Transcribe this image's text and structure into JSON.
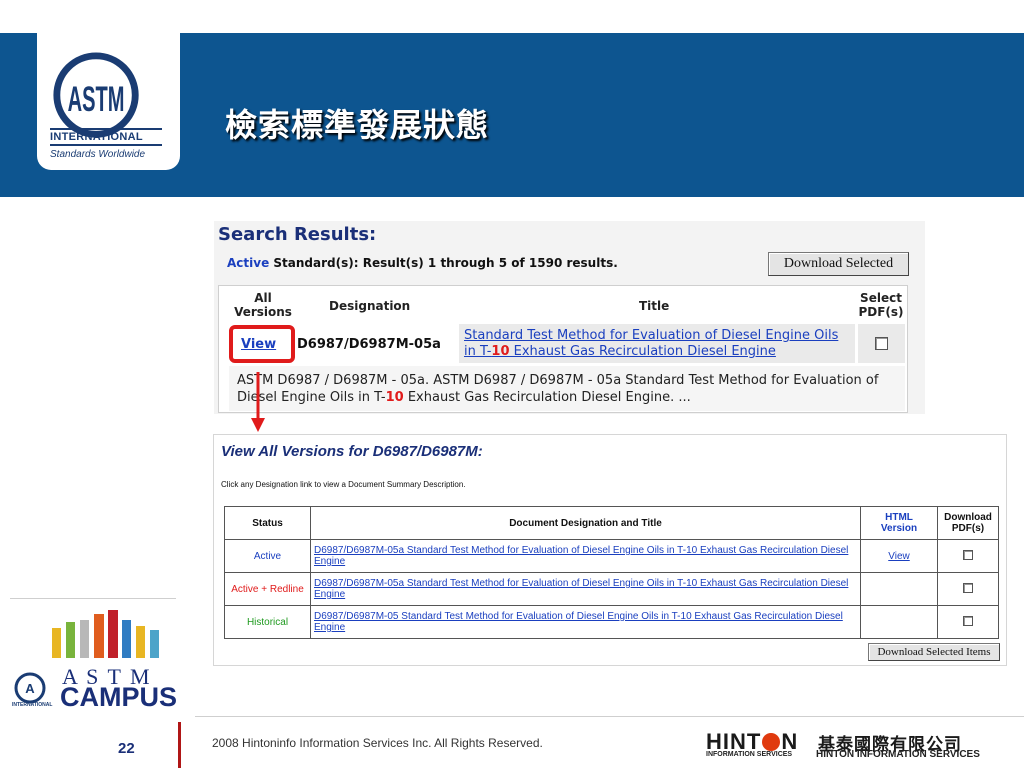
{
  "header": {
    "title": "檢索標準發展狀態",
    "logo": {
      "text": "ASTM",
      "intl": "INTERNATIONAL",
      "tagline": "Standards Worldwide"
    },
    "band_color": "#0d5590"
  },
  "search": {
    "heading": "Search Results:",
    "summary_status": "Active",
    "summary_rest": "Standard(s): Result(s) 1 through 5 of 1590 results.",
    "download_button": "Download Selected",
    "columns": {
      "all_versions_1": "All",
      "all_versions_2": "Versions",
      "designation": "Designation",
      "title": "Title",
      "select_1": "Select",
      "select_2": "PDF(s)"
    },
    "row": {
      "view": "View",
      "designation": "D6987/D6987M-05a",
      "title_a": "Standard Test Method for Evaluation of Diesel Engine Oils in T-",
      "title_hl": "10",
      "title_b": " Exhaust Gas Recirculation Diesel Engine",
      "desc_a": "ASTM D6987 / D6987M - 05a. ASTM D6987 / D6987M - 05a Standard Test Method for Evaluation of Diesel Engine Oils in T-",
      "desc_hl": "10",
      "desc_b": " Exhaust Gas Recirculation Diesel Engine. ..."
    }
  },
  "versions": {
    "heading": "View All Versions for D6987/D6987M:",
    "instruction": "Click any Designation link to view a Document Summary Description.",
    "headers": {
      "status": "Status",
      "doc": "Document Designation and Title",
      "html_1": "HTML",
      "html_2": "Version",
      "dl_1": "Download",
      "dl_2": "PDF(s)"
    },
    "rows": [
      {
        "status": "Active",
        "status_color": "#1a3fbf",
        "doc": "D6987/D6987M-05a Standard Test Method for Evaluation of Diesel Engine Oils in T-10 Exhaust Gas Recirculation Diesel Engine",
        "html": "View"
      },
      {
        "status": "Active + Redline",
        "status_color": "#e01b1b",
        "doc": "D6987/D6987M-05a Standard Test Method for Evaluation of Diesel Engine Oils in T-10 Exhaust Gas Recirculation Diesel Engine",
        "html": ""
      },
      {
        "status": "Historical",
        "status_color": "#1f9a1f",
        "doc": "D6987/D6987M-05 Standard Test Method for Evaluation of Diesel Engine Oils in T-10 Exhaust Gas Recirculation Diesel Engine",
        "html": ""
      }
    ],
    "download_button": "Download Selected Items"
  },
  "campus": {
    "line1": "A S T M",
    "line2": "CAMPUS",
    "small": "INTERNATIONAL"
  },
  "footer": {
    "page": "22",
    "copyright": "2008 Hintoninfo Information Services Inc. All Rights Reserved.",
    "hinton_left": "HINT",
    "hinton_right": "N",
    "hinton_cn": "基泰國際有限公司",
    "hinton_sub": "INFORMATION SERVICES",
    "hinton_sub2": "HINTON  INFORMATION  SERVICES"
  },
  "icons": [
    "astm-logo-icon",
    "red-arrow-icon",
    "checkbox-icon",
    "campus-hands-icon"
  ]
}
